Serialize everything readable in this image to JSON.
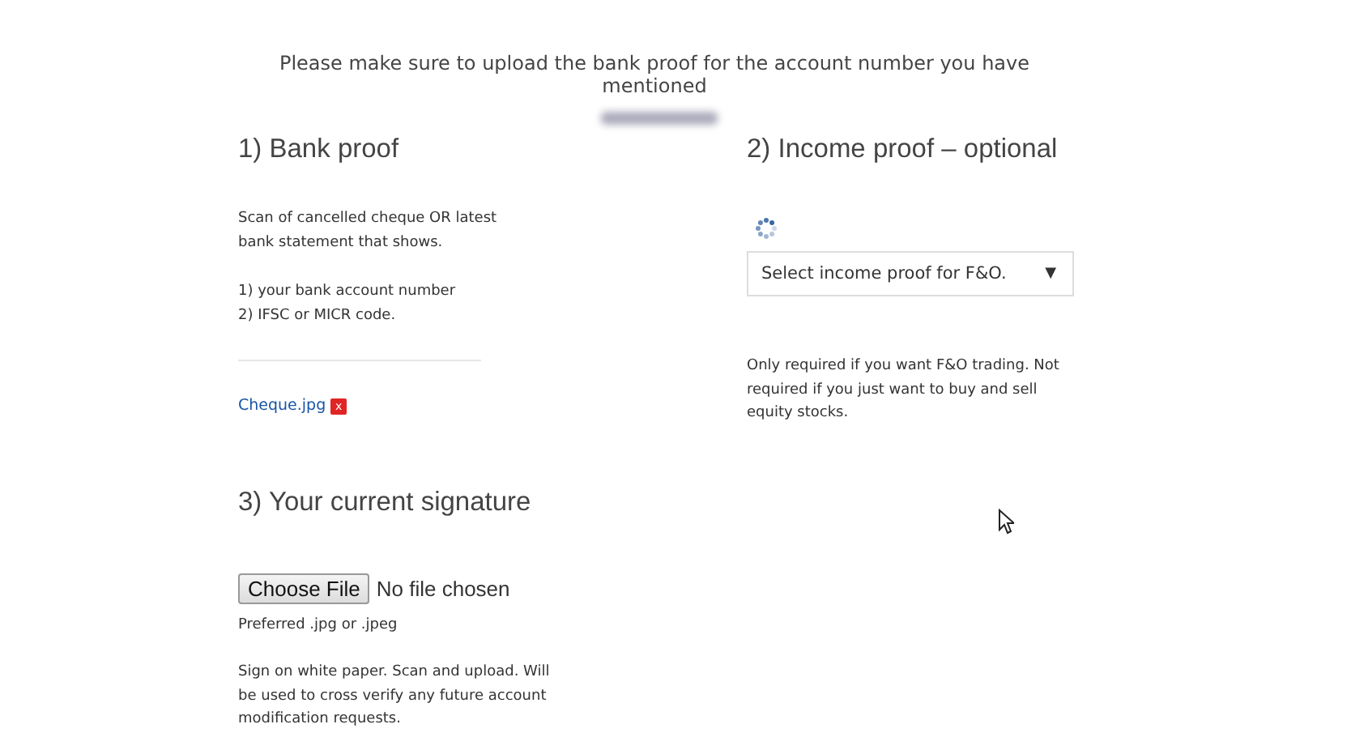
{
  "notice": "Please make sure to upload the bank proof for the account number you have mentioned",
  "bank_proof": {
    "heading": "1) Bank proof",
    "description": "Scan of cancelled cheque OR latest bank statement that shows.",
    "requirements": [
      "1) your bank account number",
      "2) IFSC or MICR code."
    ],
    "uploaded_file": "Cheque.jpg",
    "remove_label": "x"
  },
  "income_proof": {
    "heading": "2) Income proof – optional",
    "select": {
      "value": "Select income proof for F&O.",
      "arrow": "▼"
    },
    "note": "Only required if you want F&O trading. Not required if you just want to buy and sell equity stocks."
  },
  "signature": {
    "heading": "3) Your current signature",
    "file_button": "Choose File",
    "file_status": "No file chosen",
    "hint": "Preferred .jpg or .jpeg",
    "description": "Sign on white paper. Scan and upload. Will be used to cross verify any future account modification requests."
  }
}
